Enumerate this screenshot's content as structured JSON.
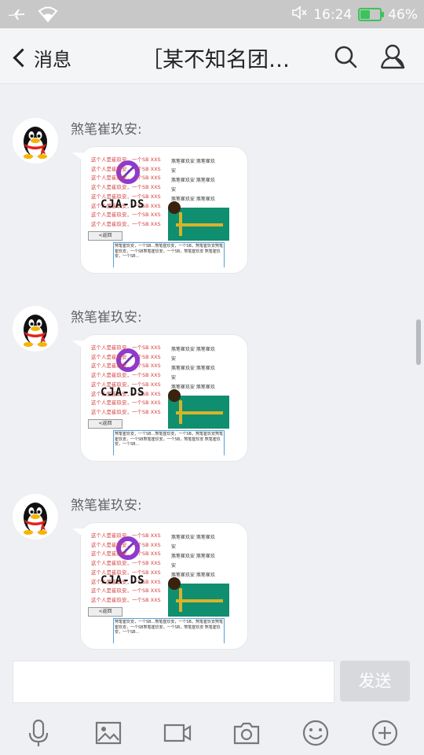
{
  "status_bar": {
    "time": "16:24",
    "battery": "46%",
    "battery_level": 0.46,
    "icons": [
      "airplane-icon",
      "wifi-icon",
      "mute-icon",
      "battery-icon"
    ]
  },
  "header": {
    "back_label": "消息",
    "title": "［某不知名团…",
    "icons": [
      "search-icon",
      "profile-icon"
    ]
  },
  "messages": [
    {
      "sender": "煞笔崔玖安:",
      "image": "screenshot-thumbnail"
    },
    {
      "sender": "煞笔崔玖安:",
      "image": "screenshot-thumbnail"
    },
    {
      "sender": "煞笔崔玖安:",
      "image": "screenshot-thumbnail"
    }
  ],
  "thumbnail": {
    "red_lines": [
      "这个人是崔玖安，一个SB XXS",
      "这个人是崔玖安，一个SB XXS",
      "这个人是崔玖安，一个SB XXS",
      "这个人是崔玖安，一个SB XXS",
      "这个人是崔玖安，一个SB XXS",
      "这个人是崔玖安，一个SB XXS",
      "这个人是崔玖安，一个SB XXS",
      "这个人是崔玖安，一个SB XXS"
    ],
    "black_lines": [
      "煞笔崔玖安  煞笔崔玖安",
      "煞笔崔玖安  煞笔崔玖安",
      "煞笔崔玖安  煞笔崔玖安",
      "煞笔崔玖安  煞笔崔玖安",
      "煞笔崔玖安  煞笔崔玖安",
      "煞笔崔玖安  煞笔崔玖安"
    ],
    "logo_text": "CJA-DS",
    "back_button": "<返回",
    "textbox": "煞笔崔玖安，一个SB...煞笔崔玖安，一个SB，煞笔崔玖安煞笔崔玖安，一个SB煞笔崔玖安，一个SB，煞笔崔玖安 煞笔崔玖安，一个SB..."
  },
  "input": {
    "placeholder": "",
    "send_label": "发送"
  },
  "toolbar": {
    "icons": [
      "microphone-icon",
      "image-icon",
      "video-icon",
      "camera-icon",
      "emoji-icon",
      "plus-icon"
    ]
  }
}
